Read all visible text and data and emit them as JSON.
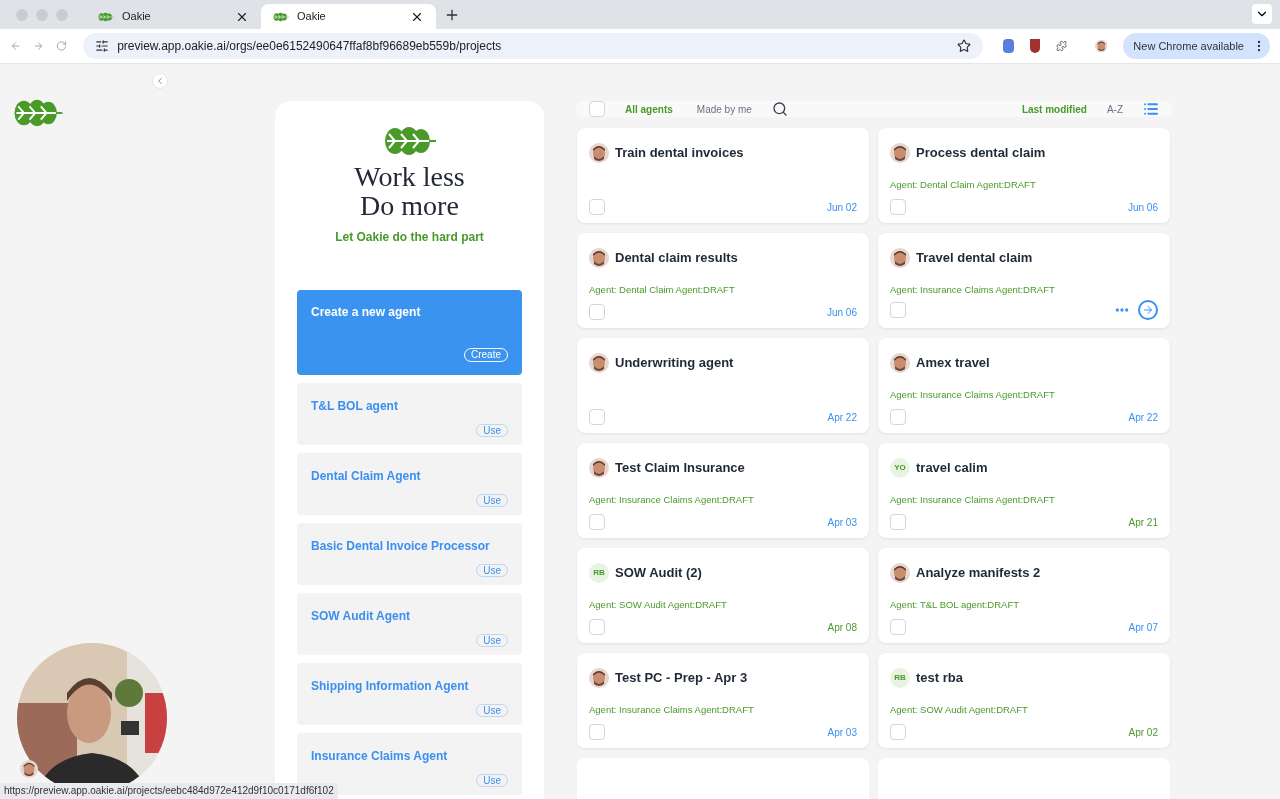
{
  "browser": {
    "tabs": [
      {
        "title": "Oakie",
        "selected": false
      },
      {
        "title": "Oakie",
        "selected": true
      }
    ],
    "url": "preview.app.oakie.ai/orgs/ee0e6152490647ffaf8bf96689eb559b/projects",
    "update_label": "New Chrome available"
  },
  "hero": {
    "heading_lines": [
      "Work less",
      "Do more"
    ],
    "tagline": "Let Oakie do the hard part"
  },
  "create_card": {
    "title": "Create a new agent",
    "button": "Create"
  },
  "templates": [
    {
      "name": "T&L BOL agent",
      "button": "Use"
    },
    {
      "name": "Dental Claim Agent",
      "button": "Use"
    },
    {
      "name": "Basic Dental Invoice Processor",
      "button": "Use"
    },
    {
      "name": "SOW Audit Agent",
      "button": "Use"
    },
    {
      "name": "Shipping Information Agent",
      "button": "Use"
    },
    {
      "name": "Insurance Claims Agent",
      "button": "Use"
    }
  ],
  "filters": [
    {
      "label": "All agents",
      "selected": true
    },
    {
      "label": "Made by me",
      "selected": false
    }
  ],
  "sorts": [
    {
      "label": "Last modified",
      "selected": true
    },
    {
      "label": "A-Z",
      "selected": false
    }
  ],
  "select_all": {
    "checked": false
  },
  "projects": [
    {
      "title": "Train dental invoices",
      "checked": false,
      "hovered": false,
      "date": "Jun 02"
    },
    {
      "title": "Process dental claim",
      "agent": "Agent: Dental Claim Agent:DRAFT",
      "checked": false,
      "hovered": false,
      "date": "Jun 06"
    },
    {
      "title": "Dental claim results",
      "agent": "Agent: Dental Claim Agent:DRAFT",
      "checked": false,
      "hovered": false,
      "date": "Jun 06"
    },
    {
      "title": "Travel dental claim",
      "agent": "Agent: Insurance Claims Agent:DRAFT",
      "checked": false,
      "hovered": true
    },
    {
      "title": "Underwriting agent",
      "checked": false,
      "hovered": false,
      "date": "Apr 22"
    },
    {
      "title": "Amex travel",
      "agent": "Agent: Insurance Claims Agent:DRAFT",
      "checked": false,
      "hovered": false,
      "date": "Apr 22"
    },
    {
      "title": "Test Claim Insurance",
      "agent": "Agent: Insurance Claims Agent:DRAFT",
      "checked": false,
      "hovered": false,
      "date": "Apr 03"
    },
    {
      "title": "travel calim",
      "avatar": {
        "kind": "initials",
        "initials": "YO"
      },
      "agent": "Agent: Insurance Claims Agent:DRAFT",
      "checked": false,
      "hovered": false,
      "date": "Apr 21"
    },
    {
      "title": "SOW Audit (2)",
      "avatar": {
        "kind": "initials",
        "initials": "RB"
      },
      "agent": "Agent: SOW Audit Agent:DRAFT",
      "checked": false,
      "hovered": false,
      "date": "Apr 08"
    },
    {
      "title": "Analyze manifests 2",
      "agent": "Agent: T&L BOL agent:DRAFT",
      "checked": false,
      "hovered": false,
      "date": "Apr 07"
    },
    {
      "title": "Test PC - Prep - Apr 3",
      "agent": "Agent: Insurance Claims Agent:DRAFT",
      "checked": false,
      "hovered": false,
      "date": "Apr 03"
    },
    {
      "title": "test rba",
      "avatar": {
        "kind": "initials",
        "initials": "RB"
      },
      "agent": "Agent: SOW Audit Agent:DRAFT",
      "checked": false,
      "hovered": false,
      "date": "Apr 02"
    }
  ],
  "status_url": "https://preview.app.oakie.ai/projects/eebc484d972e412d9f10c0171df6f102"
}
